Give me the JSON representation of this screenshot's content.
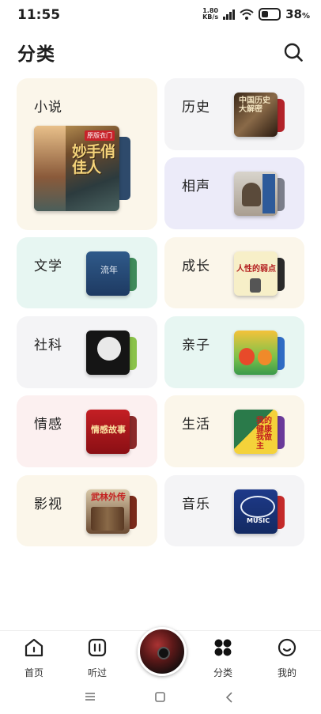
{
  "status": {
    "time": "11:55",
    "net_speed_value": "1.80",
    "net_speed_unit": "KB/s",
    "battery_percent": "38",
    "battery_unit": "%"
  },
  "header": {
    "title": "分类",
    "search_icon": "search-icon"
  },
  "categories": {
    "novel": {
      "label": "小说",
      "cover_text": "妙手俏佳人",
      "cover_badge": "原版衣门"
    },
    "history": {
      "label": "历史",
      "cover_text": "中国历史大解密"
    },
    "crosstalk": {
      "label": "相声"
    },
    "literature": {
      "label": "文学",
      "cover_text": "流年"
    },
    "growth": {
      "label": "成长",
      "cover_text": "人性的弱点"
    },
    "social_science": {
      "label": "社科"
    },
    "parenting": {
      "label": "亲子"
    },
    "emotion": {
      "label": "情感",
      "cover_text": "情感故事"
    },
    "life": {
      "label": "生活",
      "cover_text": "我的健康我做主"
    },
    "film": {
      "label": "影视",
      "cover_text": "武林外传"
    },
    "music": {
      "label": "音乐",
      "cover_text": "MUSIC"
    }
  },
  "bottom_nav": {
    "home": "首页",
    "listened": "听过",
    "categories": "分类",
    "mine": "我的"
  },
  "colors": {
    "novel_bg": "#fbf6ea",
    "history_bg": "#f4f4f6",
    "crosstalk_bg": "#ecebf9",
    "literature_bg": "#e7f6f2",
    "growth_bg": "#fbf6ea",
    "social_bg": "#f4f4f6",
    "parenting_bg": "#e7f6f2",
    "emotion_bg": "#fcf0f0",
    "life_bg": "#fbf6ea",
    "film_bg": "#fbf6ea",
    "music_bg": "#f4f4f6"
  }
}
